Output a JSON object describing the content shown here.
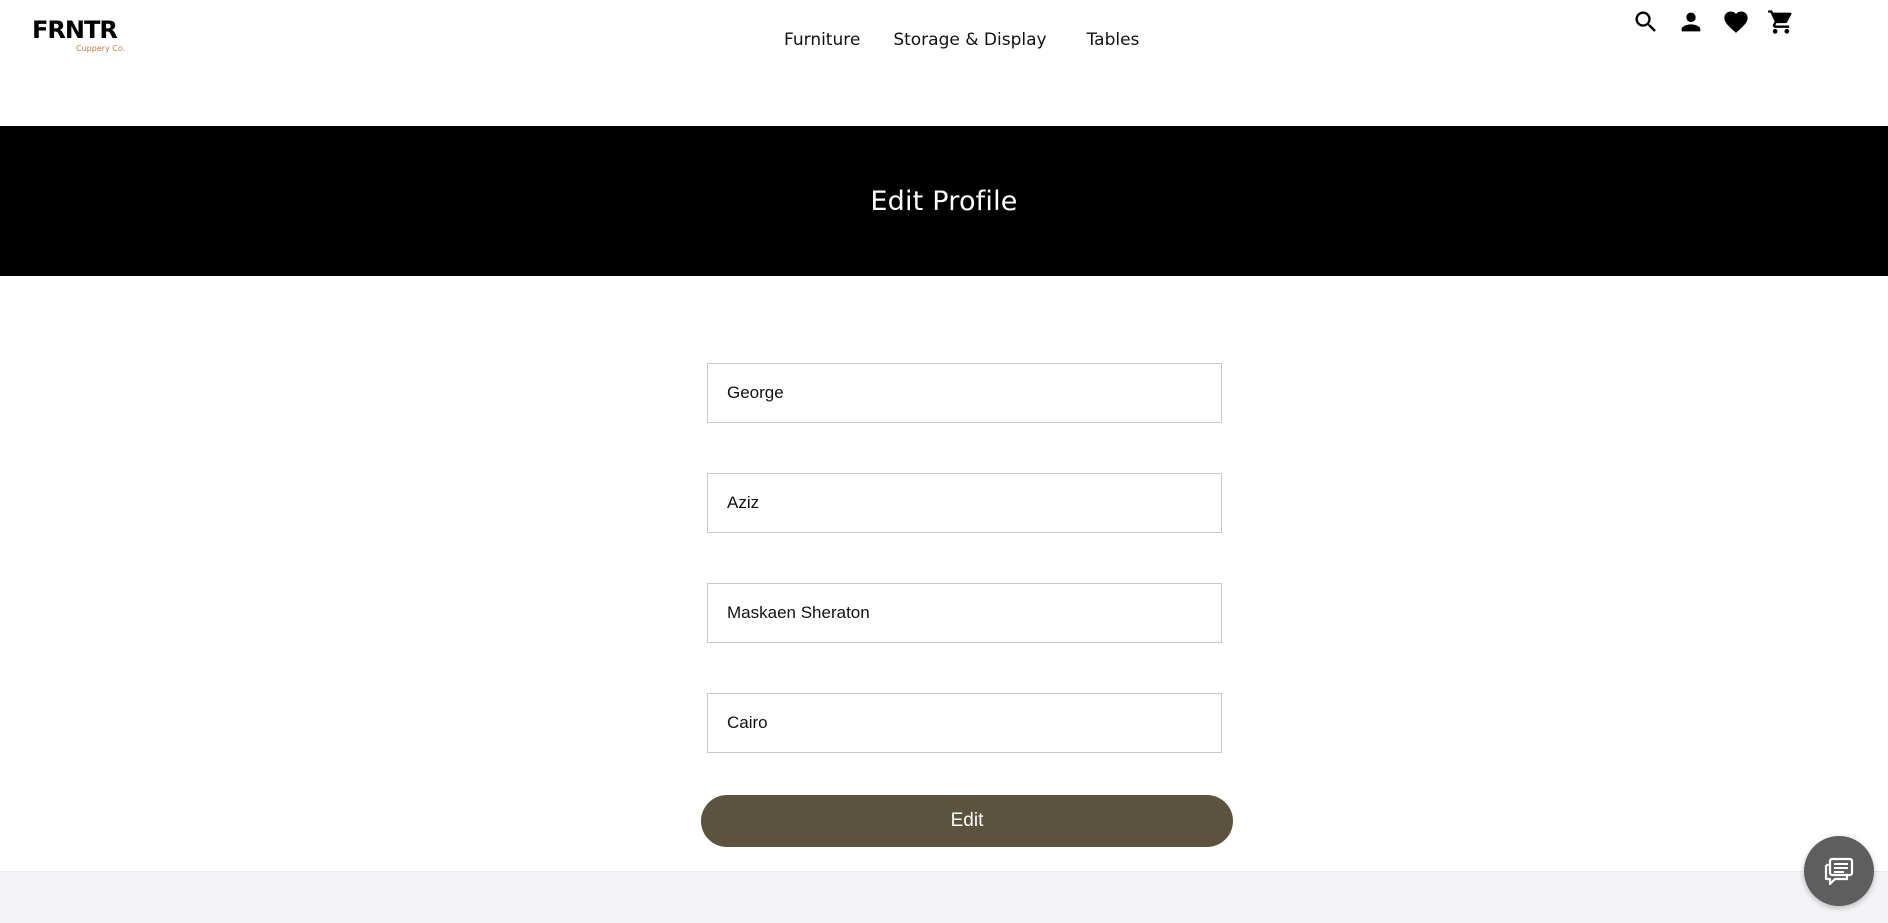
{
  "brand": {
    "name": "FRNTR",
    "tagline": "Cuppery Co."
  },
  "nav": {
    "items": [
      {
        "label": "Furniture"
      },
      {
        "label": "Storage & Display"
      },
      {
        "label": "Tables"
      }
    ]
  },
  "header_icons": [
    "search-icon",
    "account-icon",
    "heart-icon",
    "cart-icon"
  ],
  "banner": {
    "title": "Edit Profile"
  },
  "form": {
    "first_name": "George",
    "last_name": "Aziz",
    "address": "Maskaen Sheraton",
    "city": "Cairo",
    "submit_label": "Edit"
  },
  "colors": {
    "banner_bg": "#000000",
    "button_bg": "#5c533f",
    "tagline": "#c97b3a",
    "footer_bg": "#f4f4f6",
    "chat_bg": "#5e5e5e"
  },
  "chat": {
    "icon": "chat-icon"
  }
}
